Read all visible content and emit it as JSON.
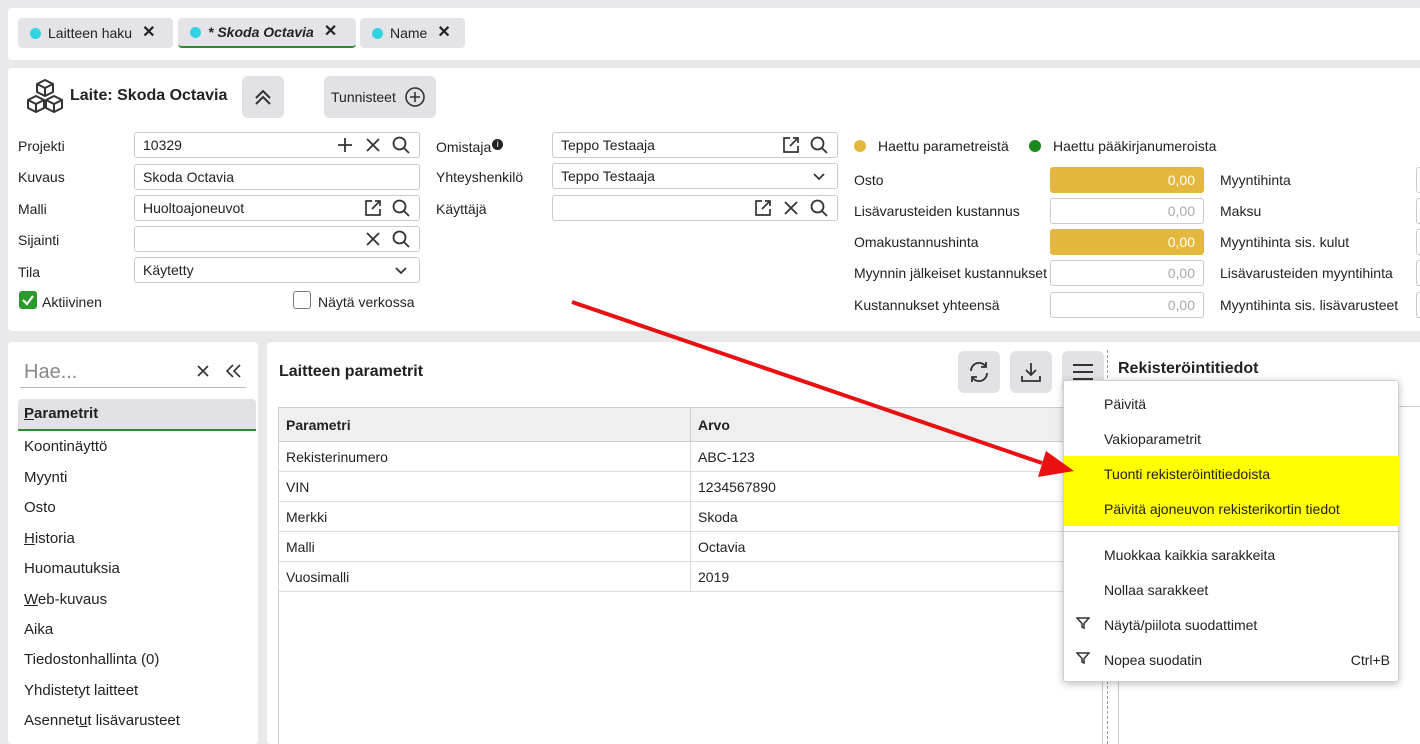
{
  "tabs": [
    {
      "label": "Laitteen haku",
      "close": "✕"
    },
    {
      "label": "* Skoda Octavia",
      "close": "✕"
    },
    {
      "label": "Name",
      "close": "✕"
    }
  ],
  "header": {
    "title": "Laite: Skoda Octavia",
    "tunnisteet_label": "Tunnisteet"
  },
  "form": {
    "projekti_label": "Projekti",
    "projekti_value": "10329",
    "kuvaus_label": "Kuvaus",
    "kuvaus_value": "Skoda Octavia",
    "malli_label": "Malli",
    "malli_value": "Huoltoajoneuvot",
    "sijainti_label": "Sijainti",
    "sijainti_value": "",
    "tila_label": "Tila",
    "tila_value": "Käytetty",
    "aktiivinen_label": "Aktiivinen",
    "nayta_verkossa_label": "Näytä verkossa",
    "omistaja_label": "Omistaja",
    "omistaja_value": "Teppo Testaaja",
    "yhteyshenkilo_label": "Yhteyshenkilö",
    "yhteyshenkilo_value": "Teppo Testaaja",
    "kayttaja_label": "Käyttäjä",
    "kayttaja_value": ""
  },
  "legend": {
    "params_label": "Haettu parametreistä",
    "params_color": "#e4b73d",
    "ledger_label": "Haettu pääkirjanumeroista",
    "ledger_color": "#1a8a1a"
  },
  "prices": {
    "osto_label": "Osto",
    "osto_value": "0,00",
    "lisavarusteiden_kustannus_label": "Lisävarusteiden kustannus",
    "lisavarusteiden_kustannus_value": "0,00",
    "omakustannushinta_label": "Omakustannushinta",
    "omakustannushinta_value": "0,00",
    "myynnin_jalkeiset_label": "Myynnin jälkeiset kustannukset",
    "myynnin_jalkeiset_value": "0,00",
    "kustannukset_yhteensa_label": "Kustannukset yhteensä",
    "kustannukset_yhteensa_value": "0,00",
    "myyntihinta_label": "Myyntihinta",
    "maksu_label": "Maksu",
    "myyntihinta_sis_kulut_label": "Myyntihinta sis. kulut",
    "lisavarusteiden_myyntihinta_label": "Lisävarusteiden myyntihinta",
    "myyntihinta_sis_lisavarusteet_label": "Myyntihinta sis. lisävarusteet"
  },
  "sidebar": {
    "search_placeholder": "Hae...",
    "items": [
      {
        "pre": "",
        "ul": "P",
        "post": "arametrit"
      },
      {
        "pre": "",
        "ul": "",
        "post": "Koontinäyttö"
      },
      {
        "pre": "",
        "ul": "",
        "post": "Myynti"
      },
      {
        "pre": "",
        "ul": "",
        "post": "Osto"
      },
      {
        "pre": "",
        "ul": "H",
        "post": "istoria"
      },
      {
        "pre": "",
        "ul": "",
        "post": "Huomautuksia"
      },
      {
        "pre": "",
        "ul": "W",
        "post": "eb-kuvaus"
      },
      {
        "pre": "",
        "ul": "",
        "post": "Aika"
      },
      {
        "pre": "",
        "ul": "",
        "post": "Tiedostonhallinta (0)"
      },
      {
        "pre": "",
        "ul": "",
        "post": "Yhdistetyt laitteet"
      },
      {
        "pre": "Asennet",
        "ul": "u",
        "post": "t lisävarusteet"
      }
    ]
  },
  "main": {
    "title": "Laitteen parametrit",
    "registration_title": "Rekisteröintitiedot",
    "columns": [
      "Parametri",
      "Arvo"
    ],
    "rows": [
      [
        "Rekisterinumero",
        "ABC-123"
      ],
      [
        "VIN",
        "1234567890"
      ],
      [
        "Merkki",
        "Skoda"
      ],
      [
        "Malli",
        "Octavia"
      ],
      [
        "Vuosimalli",
        "2019"
      ]
    ]
  },
  "menu": {
    "items": [
      {
        "label": "Päivitä"
      },
      {
        "label": "Vakioparametrit"
      },
      {
        "label": "Tuonti rekisteröintitiedoista"
      },
      {
        "label": "Päivitä ajoneuvon rekisterikortin tiedot"
      },
      {
        "label": "Muokkaa kaikkia sarakkeita"
      },
      {
        "label": "Nollaa sarakkeet"
      },
      {
        "label": "Näytä/piilota suodattimet"
      },
      {
        "label": "Nopea suodatin",
        "shortcut": "Ctrl+B"
      }
    ],
    "highlight_color": "#ffff00"
  },
  "annotation": {
    "arrow_color": "#e81010"
  }
}
